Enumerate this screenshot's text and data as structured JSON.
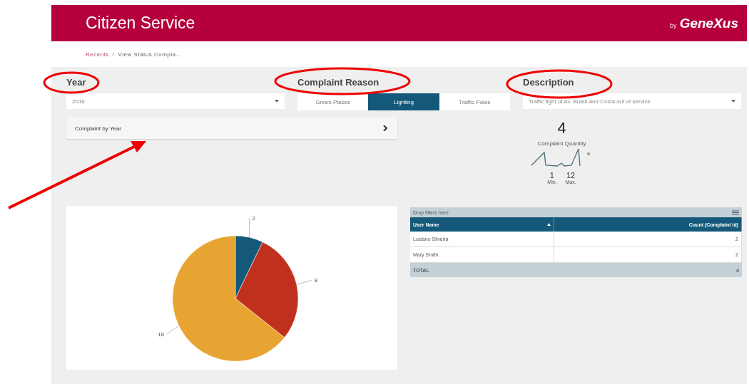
{
  "header": {
    "title": "Citizen Service",
    "brand_prefix": "by",
    "brand": "GeneXus"
  },
  "breadcrumb": [
    {
      "label": "Recents",
      "link": true
    },
    {
      "label": "/",
      "link": false
    },
    {
      "label": "View Status Compla...",
      "link": false
    }
  ],
  "filters": {
    "year": {
      "label": "Year",
      "value": "2016"
    },
    "reason": {
      "label": "Complaint Reason",
      "options": [
        {
          "label": "Green Places",
          "selected": false
        },
        {
          "label": "Lighting",
          "selected": true
        },
        {
          "label": "Traffic Poles",
          "selected": false
        }
      ]
    },
    "description": {
      "label": "Description",
      "value": "Traffic light of Av. Brasil and Costa out of service"
    }
  },
  "accordion": {
    "title": "Complaint by Year",
    "expanded": false
  },
  "kpi": {
    "value": "4",
    "label": "Complaint Quantity",
    "min": "1",
    "min_label": "Min.",
    "max": "12",
    "max_label": "Max."
  },
  "pie": {
    "chart_data": {
      "type": "pie",
      "values": [
        2,
        8,
        18
      ],
      "value_labels": [
        "2",
        "8",
        "18"
      ]
    }
  },
  "pivot": {
    "drop_hint": "Drop filters here",
    "columns": [
      {
        "label": "User Name",
        "sorted": true
      },
      {
        "label": "Count (Complaint Id)",
        "sorted": false
      }
    ],
    "rows": [
      {
        "name": "Luciano Silveira",
        "count": "2"
      },
      {
        "name": "Mary Smith",
        "count": "2"
      }
    ],
    "total": {
      "label": "TOTAL",
      "count": "4"
    }
  }
}
